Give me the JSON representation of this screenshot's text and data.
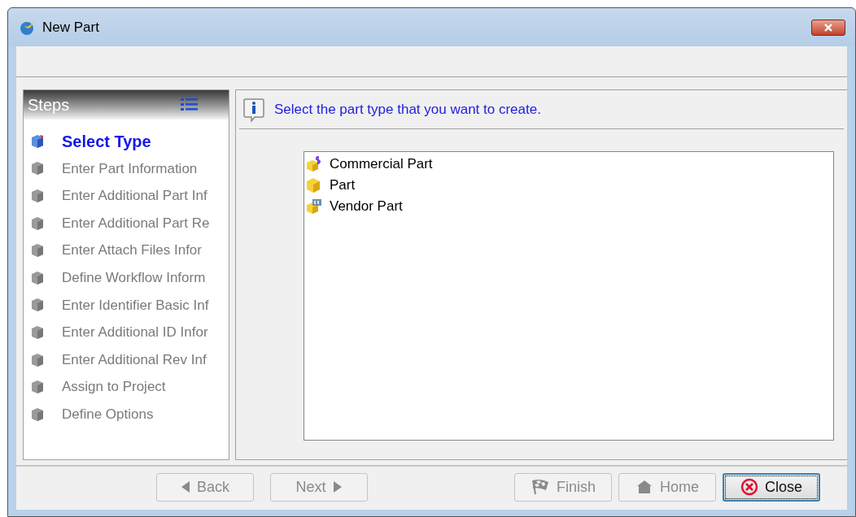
{
  "window": {
    "title": "New Part"
  },
  "steps_panel": {
    "title": "Steps",
    "items": [
      {
        "label": "Select Type",
        "selected": true
      },
      {
        "label": "Enter Part Information",
        "selected": false
      },
      {
        "label": "Enter Additional Part Inf",
        "selected": false
      },
      {
        "label": "Enter Additional Part Re",
        "selected": false
      },
      {
        "label": "Enter Attach Files Infor",
        "selected": false
      },
      {
        "label": "Define Workflow Inform",
        "selected": false
      },
      {
        "label": "Enter Identifier Basic Inf",
        "selected": false
      },
      {
        "label": "Enter Additional ID Infor",
        "selected": false
      },
      {
        "label": "Enter Additional Rev Inf",
        "selected": false
      },
      {
        "label": "Assign to Project",
        "selected": false
      },
      {
        "label": "Define Options",
        "selected": false
      }
    ]
  },
  "instruction": "Select the part type that you want to create.",
  "part_types": [
    {
      "label": "Commercial Part",
      "kind": "commercial"
    },
    {
      "label": "Part",
      "kind": "part"
    },
    {
      "label": "Vendor Part",
      "kind": "vendor"
    }
  ],
  "buttons": [
    {
      "label": "Back",
      "kind": "back",
      "disabled": true
    },
    {
      "label": "Next",
      "kind": "next",
      "disabled": true
    },
    {
      "label": "Finish",
      "kind": "finish",
      "disabled": true
    },
    {
      "label": "Home",
      "kind": "home",
      "disabled": true
    },
    {
      "label": "Close",
      "kind": "close",
      "disabled": false
    }
  ]
}
